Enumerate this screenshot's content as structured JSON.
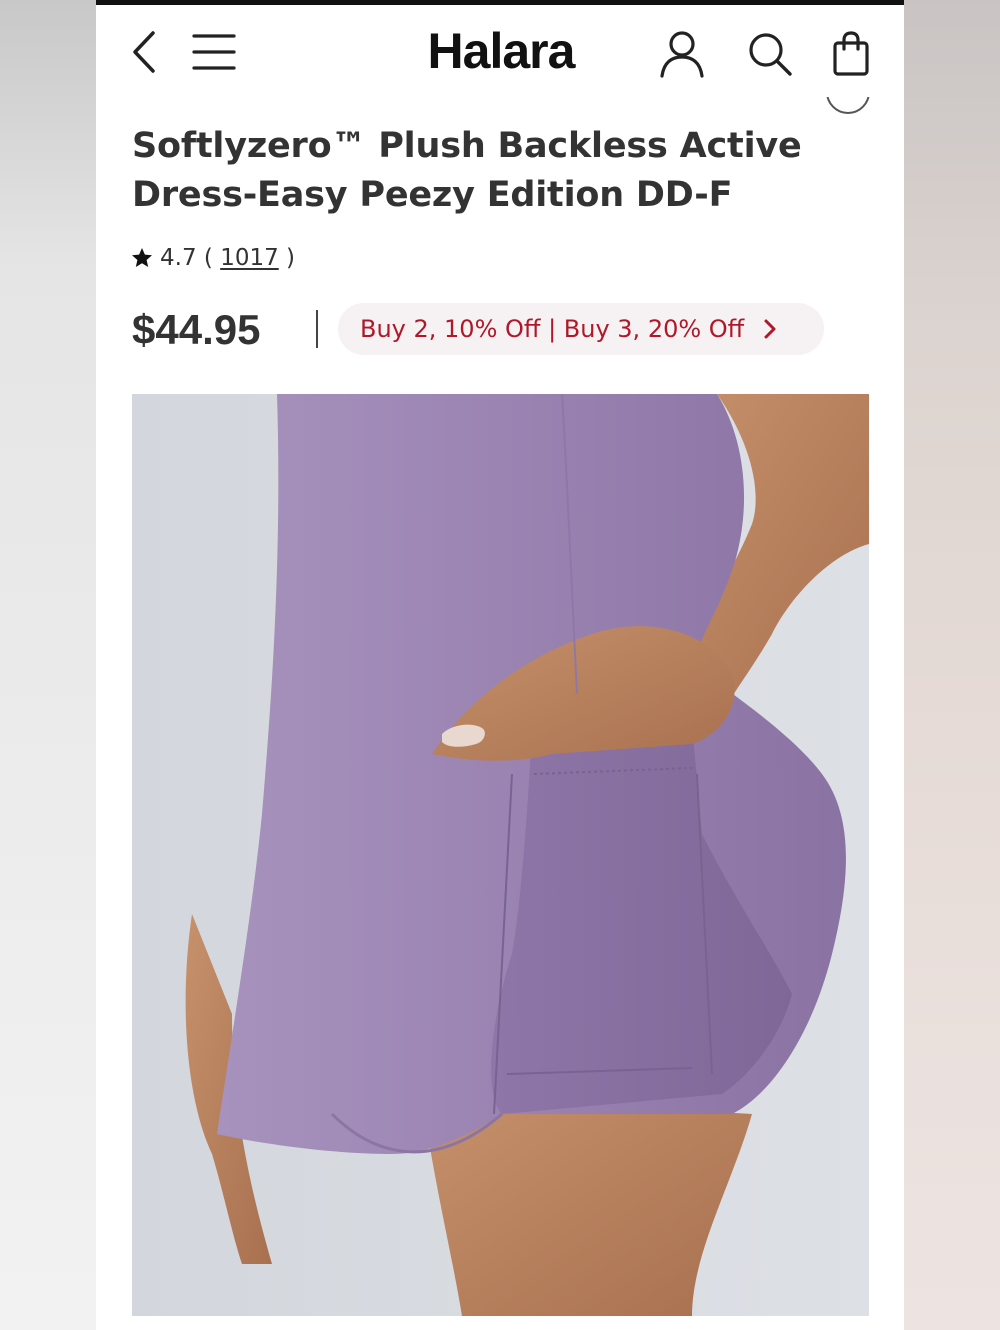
{
  "header": {
    "brand": "Halara"
  },
  "product": {
    "title": "Softlyzero™ Plush Backless Active Dress-Easy Peezy Edition DD-F",
    "rating": "4.7",
    "review_count": "1017",
    "price": "$44.95",
    "promo": "Buy 2, 10% Off | Buy 3, 20% Off"
  },
  "colors": {
    "promo_text": "#b0182a",
    "promo_bg": "#f6f1f2",
    "dress": "#9c84b3"
  },
  "icons": [
    "back-chevron-icon",
    "hamburger-menu-icon",
    "account-icon",
    "search-icon",
    "shopping-bag-icon",
    "star-icon",
    "chevron-right-icon"
  ]
}
